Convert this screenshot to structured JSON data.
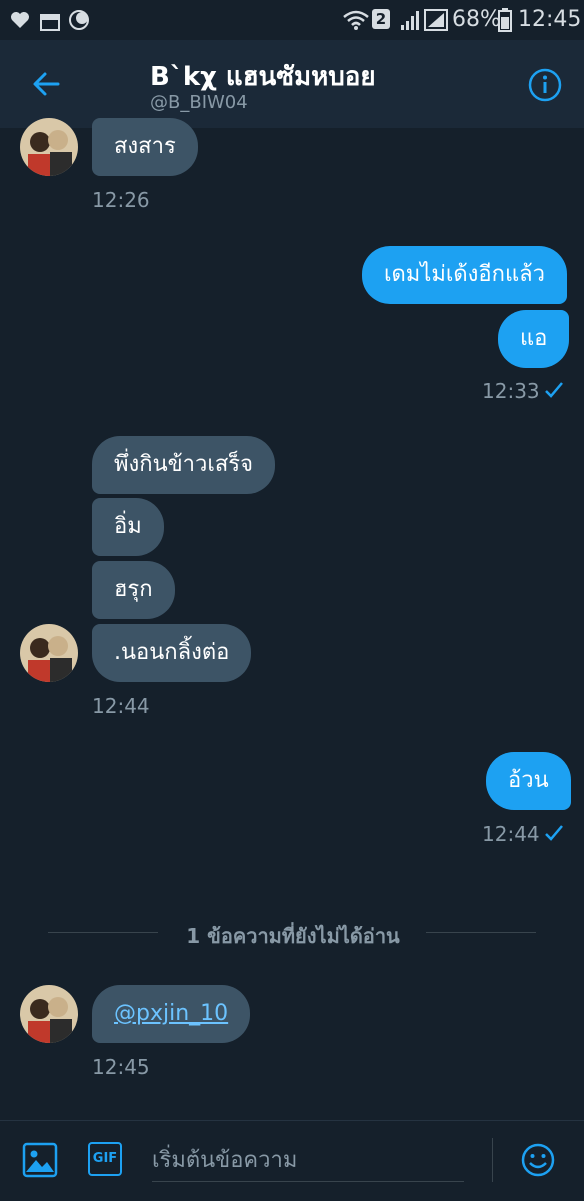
{
  "status_bar": {
    "sim_badge": "2",
    "battery_percent": "68%",
    "clock": "12:45"
  },
  "header": {
    "name": "B`kχ แฮนซัมหบอย",
    "handle": "@B_BIW04"
  },
  "messages": [
    {
      "text": "สงสาร"
    },
    {
      "time": "12:26"
    },
    {
      "text": "เดมไม่เด้งอีกแล้ว"
    },
    {
      "text": "แอ"
    },
    {
      "time": "12:33"
    },
    {
      "text": "พึ่งกินข้าวเสร็จ"
    },
    {
      "text": "อิ่ม"
    },
    {
      "text": "ฮรุก"
    },
    {
      "text": ".นอนกลิ้งต่อ"
    },
    {
      "time": "12:44"
    },
    {
      "text": "อ้วน"
    },
    {
      "time": "12:44"
    },
    {
      "text": "@pxjin_10"
    },
    {
      "time": "12:45"
    }
  ],
  "unread_divider": "1 ข้อความที่ยังไม่ได้อ่าน",
  "composer": {
    "placeholder": "เริ่มต้นข้อความ",
    "gif_label": "GIF"
  },
  "colors": {
    "background": "#15202b",
    "header": "#1b2938",
    "received_bubble": "#3d5466",
    "sent_bubble": "#1da1f2",
    "accent": "#1da1f2"
  }
}
